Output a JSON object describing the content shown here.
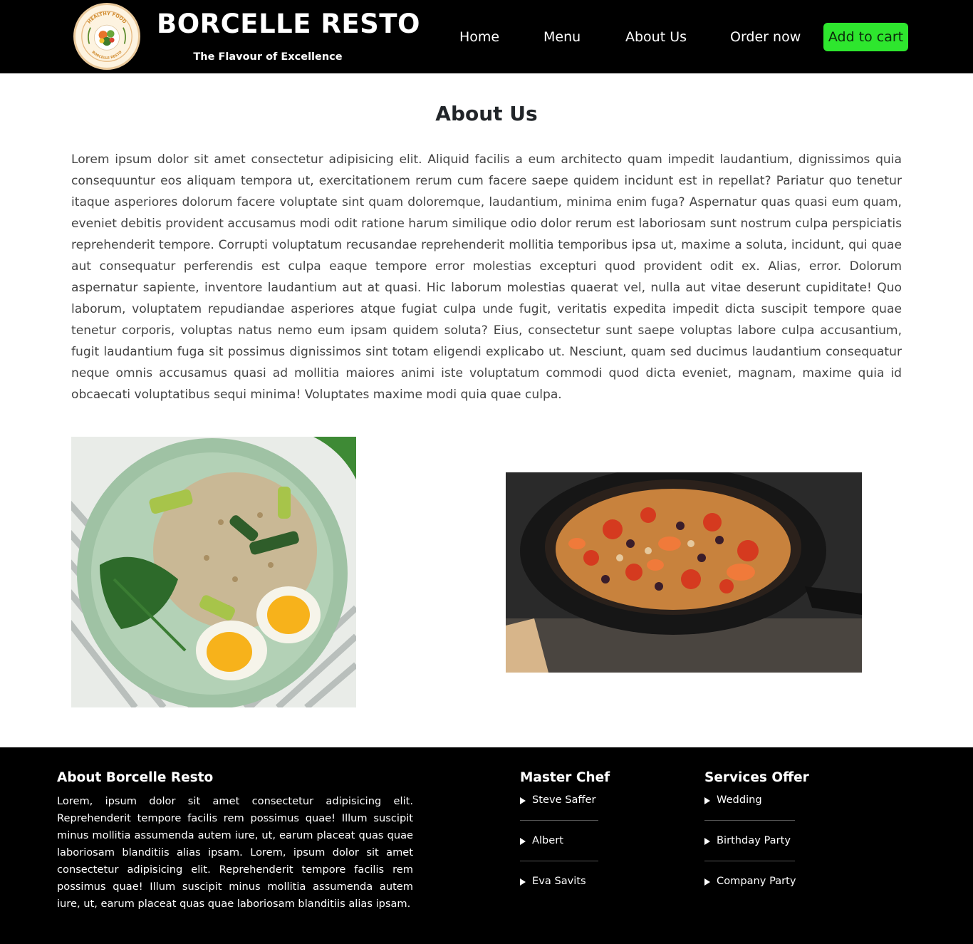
{
  "header": {
    "brand_title": "BORCELLE RESTO",
    "brand_subtitle": "The Flavour of Excellence",
    "logo": {
      "icon": "healthy-food-logo",
      "ring_text_top": "HEALTHY FOOD",
      "ring_text_bottom": "BORCELLE RESTO"
    },
    "nav": [
      {
        "label": "Home"
      },
      {
        "label": "Menu"
      },
      {
        "label": "About Us"
      },
      {
        "label": "Order now"
      }
    ],
    "cart_button": "Add to cart",
    "cart_color": "#2ee62e"
  },
  "about": {
    "title": "About Us",
    "text": "Lorem ipsum dolor sit amet consectetur adipisicing elit. Aliquid facilis a eum architecto quam impedit laudantium, dignissimos quia consequuntur eos aliquam tempora ut, exercitationem rerum cum facere saepe quidem incidunt est in repellat? Pariatur quo tenetur itaque asperiores dolorum facere voluptate sint quam doloremque, laudantium, minima enim fuga? Aspernatur quas quasi eum quam, eveniet debitis provident accusamus modi odit ratione harum similique odio dolor rerum est laboriosam sunt nostrum culpa perspiciatis reprehenderit tempore. Corrupti voluptatum recusandae reprehenderit mollitia temporibus ipsa ut, maxime a soluta, incidunt, qui quae aut consequatur perferendis est culpa eaque tempore error molestias excepturi quod provident odit ex. Alias, error. Dolorum aspernatur sapiente, inventore laudantium aut at quasi. Hic laborum molestias quaerat vel, nulla aut vitae deserunt cupiditate! Quo laborum, voluptatem repudiandae asperiores atque fugiat culpa unde fugit, veritatis expedita impedit dicta suscipit tempore quae tenetur corporis, voluptas natus nemo eum ipsam quidem soluta? Eius, consectetur sunt saepe voluptas labore culpa accusantium, fugit laudantium fuga sit possimus dignissimos sint totam eligendi explicabo ut. Nesciunt, quam sed ducimus laudantium consequatur neque omnis accusamus quasi ad mollitia maiores animi iste voluptatum commodi quod dicta eveniet, magnam, maxime quia id obcaecati voluptatibus sequi minima! Voluptates maxime modi quia quae culpa.",
    "images": [
      {
        "icon": "rice-bowl-egg-photo"
      },
      {
        "icon": "vegetable-skillet-photo"
      }
    ]
  },
  "footer": {
    "about_heading": "About Borcelle Resto",
    "about_text": "Lorem, ipsum dolor sit amet consectetur adipisicing elit. Reprehenderit tempore facilis rem possimus quae! Illum suscipit minus mollitia assumenda autem iure, ut, earum placeat quas quae laboriosam blanditiis alias ipsam. Lorem, ipsum dolor sit amet consectetur adipisicing elit. Reprehenderit tempore facilis rem possimus quae! Illum suscipit minus mollitia assumenda autem iure, ut, earum placeat quas quae laboriosam blanditiis alias ipsam.",
    "chef_heading": "Master Chef",
    "chefs": [
      "Steve Saffer",
      "Albert",
      "Eva Savits"
    ],
    "services_heading": "Services Offer",
    "services": [
      "Wedding",
      "Birthday Party",
      "Company Party"
    ]
  }
}
